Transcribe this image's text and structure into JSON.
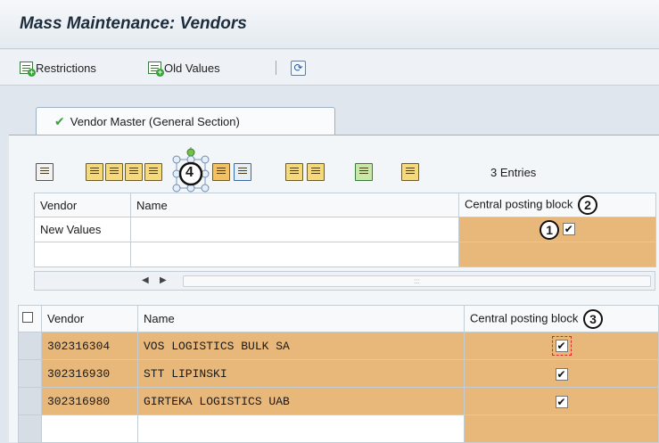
{
  "app": {
    "title": "Mass Maintenance: Vendors"
  },
  "toolbar": {
    "restrictions_label": "Restrictions",
    "old_values_label": "Old Values"
  },
  "tab": {
    "label": "Vendor Master (General Section)"
  },
  "entries_text": "3  Entries",
  "markers": {
    "m1": "1",
    "m2": "2",
    "m3": "3",
    "m4": "4"
  },
  "new_values_grid": {
    "headers": {
      "vendor": "Vendor",
      "name": "Name",
      "central_posting_block": "Central posting block"
    },
    "rows": [
      {
        "vendor": "New Values",
        "name": "",
        "central_posting_block": true
      },
      {
        "vendor": "",
        "name": "",
        "central_posting_block": null
      }
    ]
  },
  "results_grid": {
    "headers": {
      "vendor": "Vendor",
      "name": "Name",
      "central_posting_block": "Central posting block"
    },
    "rows": [
      {
        "vendor": "302316304",
        "name": "VOS LOGISTICS BULK SA",
        "central_posting_block": true
      },
      {
        "vendor": "302316930",
        "name": "STT LIPINSKI",
        "central_posting_block": true
      },
      {
        "vendor": "302316980",
        "name": "GIRTEKA LOGISTICS UAB",
        "central_posting_block": true
      }
    ]
  },
  "colors": {
    "highlight": "#e8b77a",
    "accent_green": "#3aa03a",
    "focus_dash": "#d42a2a"
  }
}
